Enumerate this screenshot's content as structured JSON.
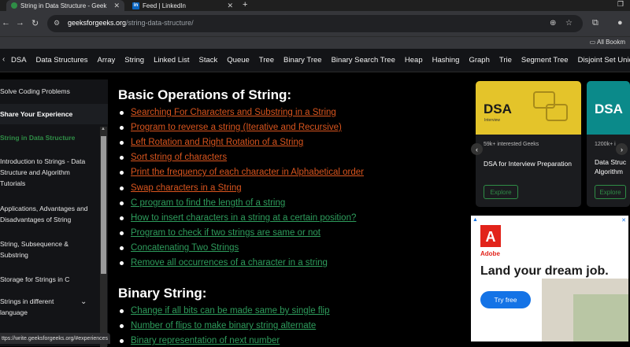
{
  "browser": {
    "tabs": [
      {
        "label": "String in Data Structure - Geek",
        "active": true
      },
      {
        "label": "Feed | LinkedIn",
        "active": false
      }
    ],
    "url_domain": "geeksforgeeks.org",
    "url_path": "/string-data-structure/",
    "bookmarks_label": "All Bookm"
  },
  "topics": [
    "DSA",
    "Data Structures",
    "Array",
    "String",
    "Linked List",
    "Stack",
    "Queue",
    "Tree",
    "Binary Tree",
    "Binary Search Tree",
    "Heap",
    "Hashing",
    "Graph",
    "Trie",
    "Segment Tree",
    "Disjoint Set Unic"
  ],
  "sidebar": {
    "solve": "Solve Coding Problems",
    "share": "Share Your Experience",
    "items": [
      "String in Data Structure",
      "Introduction to Strings - Data Structure and Algorithm Tutorials",
      "Applications, Advantages and Disadvantages of String",
      "String, Subsequence & Substring",
      "Storage for Strings in C",
      "Strings in different language"
    ]
  },
  "main": {
    "section1_title": "Basic Operations of String:",
    "section1_links": [
      "Searching For Characters and Substring in a String",
      "Program to reverse a string (Iterative and Recursive)",
      "Left Rotation and Right Rotation of a String",
      "Sort string of characters",
      "Print the frequency of each character in Alphabetical order",
      "Swap characters in a String",
      "C program to find the length of a string",
      "How to insert characters in a string at a certain position?",
      "Program to check if two strings are same or not",
      "Concatenating Two Strings",
      "Remove all occurrences of a character in a string"
    ],
    "section2_title": "Binary String:",
    "section2_links": [
      "Change if all bits can be made same by single flip",
      "Number of flips to make binary string alternate",
      "Binary representation of next number"
    ]
  },
  "cards": [
    {
      "art_title": "DSA",
      "art_sub": "Interview",
      "meta": "59k+ interested Geeks",
      "title": "DSA for Interview Preparation",
      "button": "Explore"
    },
    {
      "art_title": "DSA",
      "art_sub": "",
      "meta": "1200k+ i",
      "title": "Data Struc Algorithm",
      "button": "Explore"
    }
  ],
  "ad": {
    "brand": "Adobe",
    "headline": "Land your dream job.",
    "cta": "Try free"
  },
  "status_url": "ttps://write.geeksforgeeks.org/#experiences"
}
